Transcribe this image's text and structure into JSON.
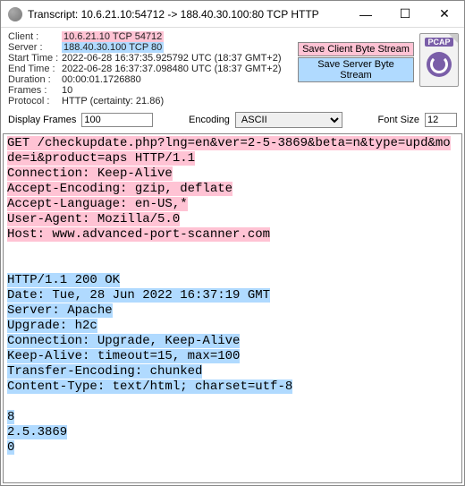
{
  "window": {
    "title": "Transcript: 10.6.21.10:54712 -> 188.40.30.100:80 TCP HTTP"
  },
  "meta": {
    "client_label": "Client :",
    "client_value": "10.6.21.10 TCP 54712",
    "server_label": "Server :",
    "server_value": "188.40.30.100 TCP 80",
    "start_label": "Start Time :",
    "start_value": "2022-06-28 16:37:35.925792 UTC   (18:37 GMT+2)",
    "end_label": "End Time :",
    "end_value": "2022-06-28 16:37:37.098480 UTC   (18:37 GMT+2)",
    "duration_label": "Duration :",
    "duration_value": "00:00:01.1726880",
    "frames_label": "Frames :",
    "frames_value": "10",
    "protocol_label": "Protocol :",
    "protocol_value": "HTTP (certainty: 21.86)"
  },
  "buttons": {
    "save_client": "Save Client Byte Stream",
    "save_server": "Save Server Byte Stream"
  },
  "pcap_label": "PCAP",
  "controls": {
    "display_frames_label": "Display Frames",
    "display_frames_value": "100",
    "encoding_label": "Encoding",
    "encoding_value": "ASCII",
    "fontsize_label": "Font Size",
    "fontsize_value": "12"
  },
  "transcript": {
    "client_block": "GET /checkupdate.php?lng=en&ver=2-5-3869&beta=n&type=upd&mode=i&product=aps HTTP/1.1\nConnection: Keep-Alive\nAccept-Encoding: gzip, deflate\nAccept-Language: en-US,*\nUser-Agent: Mozilla/5.0\nHost: www.advanced-port-scanner.com",
    "server_block1": "HTTP/1.1 200 OK\nDate: Tue, 28 Jun 2022 16:37:19 GMT\nServer: Apache\nUpgrade: h2c\nConnection: Upgrade, Keep-Alive\nKeep-Alive: timeout=15, max=100\nTransfer-Encoding: chunked\nContent-Type: text/html; charset=utf-8",
    "server_block2": "8\n2.5.3869\n0"
  }
}
